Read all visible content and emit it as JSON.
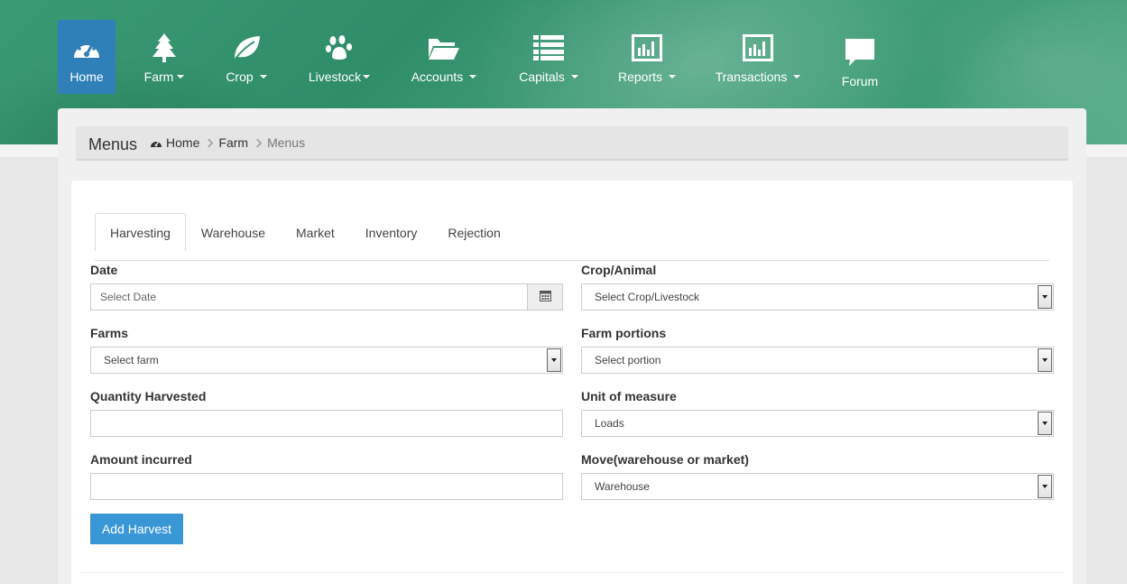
{
  "nav": {
    "items": [
      {
        "label": "Home",
        "icon": "dashboard-icon",
        "active": true
      },
      {
        "label": "Farm",
        "icon": "tree-icon",
        "caret": true
      },
      {
        "label": "Crop",
        "icon": "leaf-icon",
        "caret": true
      },
      {
        "label": "Livestock",
        "icon": "paw-icon",
        "caret": true
      },
      {
        "label": "Accounts",
        "icon": "folder-open-icon",
        "caret": true
      },
      {
        "label": "Capitals",
        "icon": "list-icon",
        "caret": true
      },
      {
        "label": "Reports",
        "icon": "bar-chart-icon",
        "caret": true
      },
      {
        "label": "Transactions",
        "icon": "bar-chart-icon",
        "caret": true
      },
      {
        "label": "Forum",
        "icon": "comment-icon"
      }
    ]
  },
  "breadcrumb": {
    "title": "Menus",
    "items": [
      "Home",
      "Farm",
      "Menus"
    ]
  },
  "tabs": [
    "Harvesting",
    "Warehouse",
    "Market",
    "Inventory",
    "Rejection"
  ],
  "form": {
    "date": {
      "label": "Date",
      "placeholder": "Select Date"
    },
    "crop_animal": {
      "label": "Crop/Animal",
      "value": "Select Crop/Livestock"
    },
    "farms": {
      "label": "Farms",
      "value": "Select farm"
    },
    "farm_portions": {
      "label": "Farm portions",
      "value": "Select portion"
    },
    "quantity": {
      "label": "Quantity Harvested",
      "value": ""
    },
    "unit": {
      "label": "Unit of measure",
      "value": "Loads"
    },
    "amount": {
      "label": "Amount incurred",
      "value": ""
    },
    "move": {
      "label": "Move(warehouse or market)",
      "value": "Warehouse"
    },
    "submit_label": "Add Harvest"
  },
  "colors": {
    "header_green": "#3a9a74",
    "active_blue": "#2f7fb9",
    "button_blue": "#3a97d6"
  }
}
